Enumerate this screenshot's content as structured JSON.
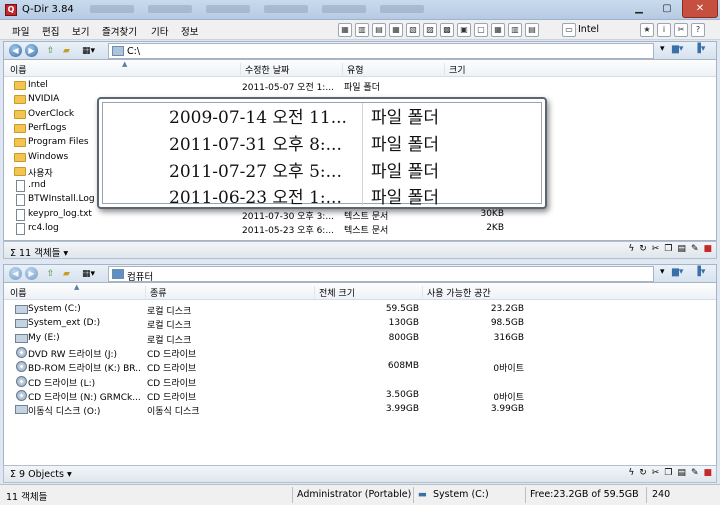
{
  "window": {
    "title": "Q-Dir 3.84",
    "app_icon": "Q"
  },
  "menu": {
    "items": [
      "파일",
      "편집",
      "보기",
      "즐겨찾기",
      "기타",
      "정보"
    ],
    "right_label": "Intel"
  },
  "top_pane": {
    "address": "C:\\",
    "columns": {
      "name": "이름",
      "modified": "수정한 날짜",
      "type": "유형",
      "size": "크기"
    },
    "rows": [
      {
        "name": "Intel",
        "modified": "2011-05-07 오전 1:...",
        "type": "파일 폴더",
        "size": "",
        "kind": "folder"
      },
      {
        "name": "NVIDIA",
        "modified": "",
        "type": "",
        "size": "",
        "kind": "folder"
      },
      {
        "name": "OverClock",
        "modified": "",
        "type": "",
        "size": "",
        "kind": "folder"
      },
      {
        "name": "PerfLogs",
        "modified": "",
        "type": "",
        "size": "",
        "kind": "folder"
      },
      {
        "name": "Program Files",
        "modified": "",
        "type": "",
        "size": "",
        "kind": "folder"
      },
      {
        "name": "Windows",
        "modified": "",
        "type": "",
        "size": "",
        "kind": "folder"
      },
      {
        "name": "사용자",
        "modified": "",
        "type": "",
        "size": "",
        "kind": "folder"
      },
      {
        "name": ".rnd",
        "modified": "",
        "type": "",
        "size": "",
        "kind": "file"
      },
      {
        "name": "BTWInstall.Log",
        "modified": "",
        "type": "",
        "size": "",
        "kind": "file"
      },
      {
        "name": "keypro_log.txt",
        "modified": "2011-07-30 오후 3:...",
        "type": "텍스트 문서",
        "size": "30KB",
        "kind": "file"
      },
      {
        "name": "rc4.log",
        "modified": "2011-05-23 오후 6:...",
        "type": "텍스트 문서",
        "size": "2KB",
        "kind": "file"
      }
    ],
    "status": "11 객체들"
  },
  "tooltip": {
    "rows": [
      {
        "date": "2009-07-14 오전 11...",
        "type": "파일 폴더"
      },
      {
        "date": "2011-07-31 오후 8:...",
        "type": "파일 폴더"
      },
      {
        "date": "2011-07-27 오후 5:...",
        "type": "파일 폴더"
      },
      {
        "date": "2011-06-23 오전 1:...",
        "type": "파일 폴더"
      }
    ]
  },
  "bottom_pane": {
    "address": "컴퓨터",
    "columns": {
      "name": "이름",
      "kind": "종류",
      "total": "전체 크기",
      "free": "사용 가능한 공간"
    },
    "rows": [
      {
        "name": "System (C:)",
        "kind": "로컬 디스크",
        "total": "59.5GB",
        "free": "23.2GB",
        "icon": "drive"
      },
      {
        "name": "System_ext (D:)",
        "kind": "로컬 디스크",
        "total": "130GB",
        "free": "98.5GB",
        "icon": "drive"
      },
      {
        "name": "My (E:)",
        "kind": "로컬 디스크",
        "total": "800GB",
        "free": "316GB",
        "icon": "drive"
      },
      {
        "name": "DVD RW 드라이브 (J:)",
        "kind": "CD 드라이브",
        "total": "",
        "free": "",
        "icon": "cd"
      },
      {
        "name": "BD-ROM 드라이브 (K:) BR...",
        "kind": "CD 드라이브",
        "total": "608MB",
        "free": "0바이트",
        "icon": "cd"
      },
      {
        "name": "CD 드라이브 (L:)",
        "kind": "CD 드라이브",
        "total": "",
        "free": "",
        "icon": "cd"
      },
      {
        "name": "CD 드라이브 (N:) GRMCk...",
        "kind": "CD 드라이브",
        "total": "3.50GB",
        "free": "0바이트",
        "icon": "cd"
      },
      {
        "name": "이동식 디스크 (O:)",
        "kind": "이동식 디스크",
        "total": "3.99GB",
        "free": "3.99GB",
        "icon": "drive"
      }
    ],
    "status": "9 Objects"
  },
  "statusbar": {
    "objects": "11 객체들",
    "user": "Administrator (Portable)",
    "drive": "System (C:)",
    "free": "Free:23.2GB of 59.5GB",
    "count": "240"
  },
  "colors": {
    "title_bg": "#c9daed",
    "close_red": "#c74f40",
    "folder": "#f3c44f"
  }
}
